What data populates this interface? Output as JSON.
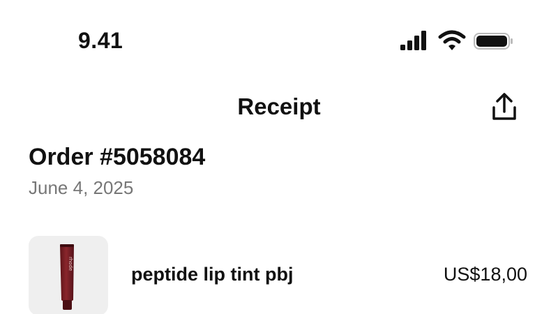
{
  "status_bar": {
    "time": "9.41",
    "icons": [
      "signal-icon",
      "wifi-icon",
      "battery-icon"
    ]
  },
  "nav": {
    "title": "Receipt",
    "share_icon": "share-icon"
  },
  "order": {
    "title": "Order #5058084",
    "date": "June 4, 2025"
  },
  "items": [
    {
      "name": "peptide lip tint pbj",
      "price": "US$18,00",
      "thumbnail_brand_text": "rhode"
    }
  ],
  "colors": {
    "text_primary": "#111111",
    "text_secondary": "#777777",
    "thumb_background": "#efefef",
    "product_tube": "#7a1f24"
  }
}
